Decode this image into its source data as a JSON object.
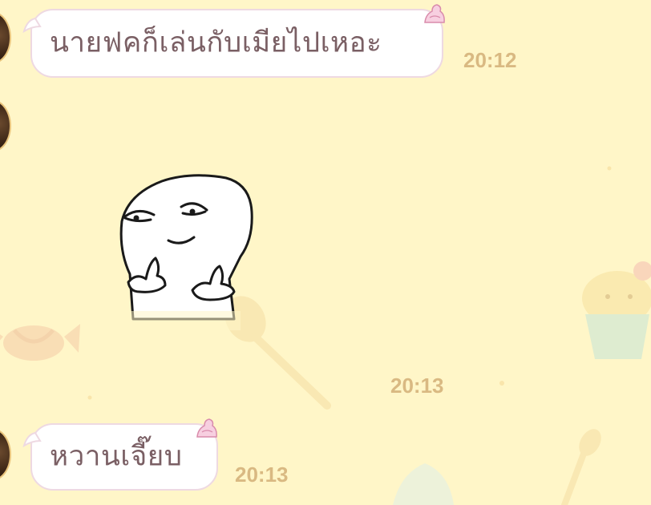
{
  "messages": [
    {
      "type": "text",
      "text": "นายฟคก็เล่นกับเมียไปเหอะ",
      "time": "20:12",
      "sender": "incoming"
    },
    {
      "type": "sticker",
      "sticker_icon": "smug-thumbs-up-sticker-icon",
      "time": "20:13",
      "sender": "incoming"
    },
    {
      "type": "text",
      "text": "หวานเจี๊ยบ",
      "time": "20:13",
      "sender": "incoming"
    }
  ],
  "theme": {
    "background": "#fff6c8",
    "bubble_border": "#eed9e2",
    "bubble_text": "#7a5f64",
    "timestamp_color": "#d9b982",
    "bubble_decoration": "whipped-cream-icon"
  }
}
